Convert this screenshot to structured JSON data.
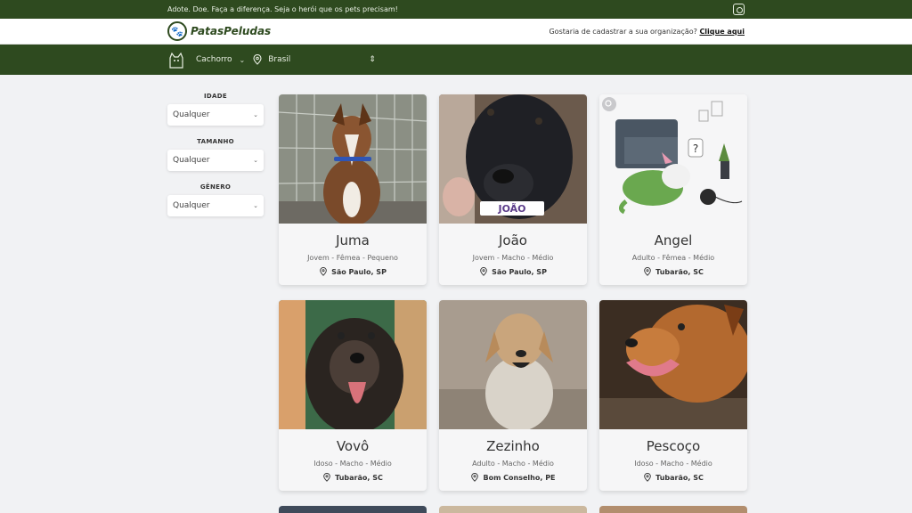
{
  "topbar": {
    "tagline": "Adote. Doe. Faça a diferença. Seja o herói que os pets precisam!",
    "social_icon": "instagram-icon"
  },
  "header": {
    "logo_text": "PatasPeludas",
    "org_prompt": "Gostaria de cadastrar a sua organização?",
    "org_link": "Clique aqui"
  },
  "filterbar": {
    "species": "Cachorro",
    "location": "Brasil"
  },
  "filters": [
    {
      "label": "IDADE",
      "value": "Qualquer"
    },
    {
      "label": "TAMANHO",
      "value": "Qualquer"
    },
    {
      "label": "GÊNERO",
      "value": "Qualquer"
    }
  ],
  "pets": [
    {
      "name": "Juma",
      "details": "Jovem - Fêmea - Pequeno",
      "city": "São Paulo, SP"
    },
    {
      "name": "João",
      "details": "Jovem - Macho - Médio",
      "city": "São Paulo, SP",
      "photo_label": "JOÃO"
    },
    {
      "name": "Angel",
      "details": "Adulto - Fêmea - Médio",
      "city": "Tubarão, SC"
    },
    {
      "name": "Vovô",
      "details": "Idoso - Macho - Médio",
      "city": "Tubarão, SC"
    },
    {
      "name": "Zezinho",
      "details": "Adulto - Macho - Médio",
      "city": "Bom Conselho, PE"
    },
    {
      "name": "Pescoço",
      "details": "Idoso - Macho - Médio",
      "city": "Tubarão, SC"
    }
  ],
  "colors": {
    "brand_green": "#2e4a1f",
    "background": "#f1f2f4"
  }
}
